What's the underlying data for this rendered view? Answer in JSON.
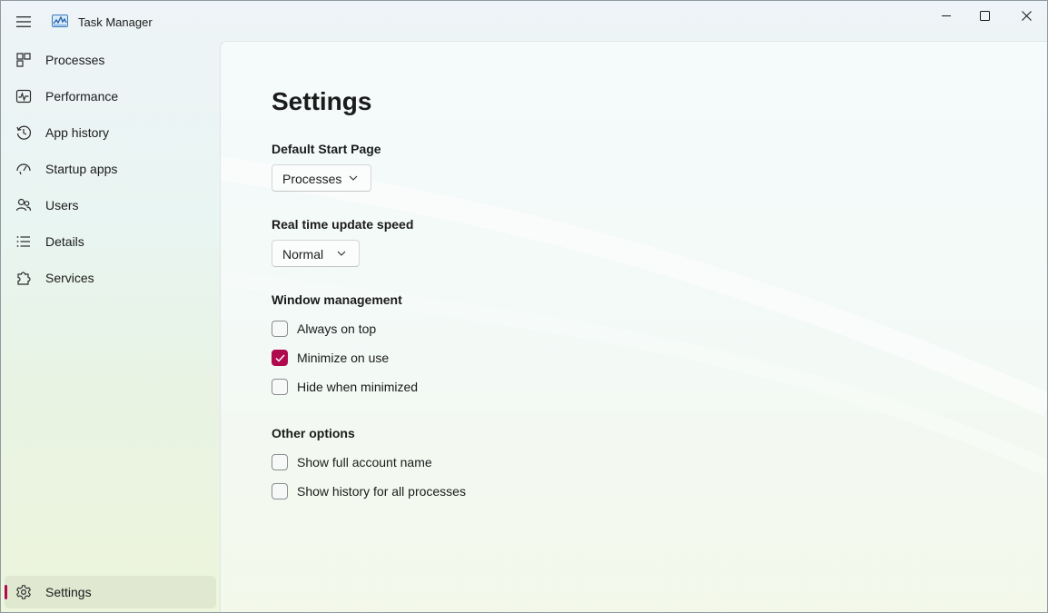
{
  "window": {
    "title": "Task Manager",
    "accent_color": "#b00a4f"
  },
  "titlebar": {
    "menu_icon": "hamburger-menu-icon",
    "app_icon": "task-manager-chart-icon",
    "minimize_icon": "minimize-icon",
    "maximize_icon": "maximize-icon",
    "close_icon": "close-icon"
  },
  "sidebar": {
    "items": [
      {
        "label": "Processes",
        "icon": "processes-grid-icon"
      },
      {
        "label": "Performance",
        "icon": "performance-pulse-icon"
      },
      {
        "label": "App history",
        "icon": "history-clock-icon"
      },
      {
        "label": "Startup apps",
        "icon": "startup-gauge-icon"
      },
      {
        "label": "Users",
        "icon": "users-icon"
      },
      {
        "label": "Details",
        "icon": "details-list-icon"
      },
      {
        "label": "Services",
        "icon": "services-puzzle-icon"
      }
    ],
    "settings": {
      "label": "Settings",
      "icon": "gear-icon",
      "selected": true
    }
  },
  "main": {
    "title": "Settings",
    "default_start_page": {
      "label": "Default Start Page",
      "selected": "Processes"
    },
    "update_speed": {
      "label": "Real time update speed",
      "selected": "Normal"
    },
    "window_management": {
      "label": "Window management",
      "options": [
        {
          "label": "Always on top",
          "checked": false
        },
        {
          "label": "Minimize on use",
          "checked": true
        },
        {
          "label": "Hide when minimized",
          "checked": false
        }
      ]
    },
    "other_options": {
      "label": "Other options",
      "options": [
        {
          "label": "Show full account name",
          "checked": false
        },
        {
          "label": "Show history for all processes",
          "checked": false
        }
      ]
    }
  }
}
